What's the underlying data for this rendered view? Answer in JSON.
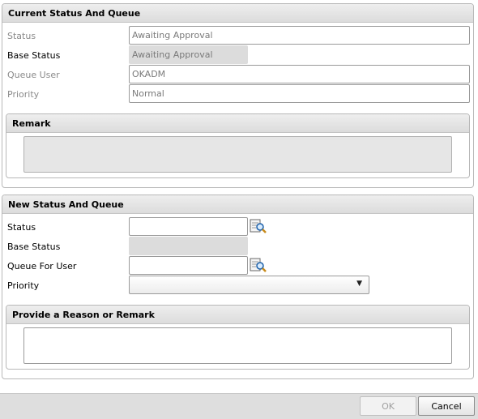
{
  "current": {
    "title": "Current Status And Queue",
    "status_label": "Status",
    "status_value": "Awaiting Approval",
    "base_status_label": "Base Status",
    "base_status_value": "Awaiting Approval",
    "queue_user_label": "Queue User",
    "queue_user_value": "OKADM",
    "priority_label": "Priority",
    "priority_value": "Normal",
    "remark_title": "Remark",
    "remark_value": ""
  },
  "new": {
    "title": "New Status And Queue",
    "status_label": "Status",
    "status_value": "",
    "base_status_label": "Base Status",
    "base_status_value": "",
    "queue_user_label": "Queue For User",
    "queue_user_value": "",
    "priority_label": "Priority",
    "priority_value": "",
    "reason_title": "Provide a Reason or Remark",
    "reason_value": ""
  },
  "footer": {
    "ok_label": "OK",
    "cancel_label": "Cancel"
  },
  "icons": {
    "lookup": "lookup-magnifier-icon",
    "dropdown": "chevron-down-icon"
  }
}
